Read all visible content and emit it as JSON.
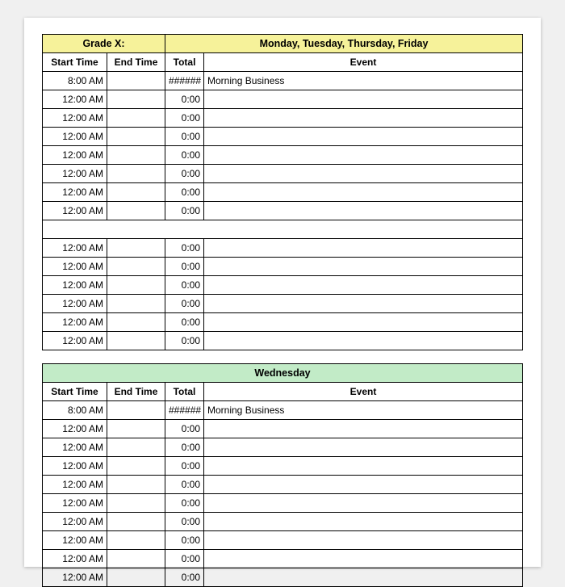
{
  "table1": {
    "title_left": "Grade X:",
    "title_right": "Monday, Tuesday, Thursday, Friday",
    "headers": {
      "start": "Start Time",
      "end": "End Time",
      "total": "Total",
      "event": "Event"
    },
    "rows": [
      {
        "start": "8:00 AM",
        "end": "",
        "total": "######",
        "event": "Morning Business"
      },
      {
        "start": "12:00 AM",
        "end": "",
        "total": "0:00",
        "event": ""
      },
      {
        "start": "12:00 AM",
        "end": "",
        "total": "0:00",
        "event": ""
      },
      {
        "start": "12:00 AM",
        "end": "",
        "total": "0:00",
        "event": ""
      },
      {
        "start": "12:00 AM",
        "end": "",
        "total": "0:00",
        "event": ""
      },
      {
        "start": "12:00 AM",
        "end": "",
        "total": "0:00",
        "event": ""
      },
      {
        "start": "12:00 AM",
        "end": "",
        "total": "0:00",
        "event": ""
      },
      {
        "start": "12:00 AM",
        "end": "",
        "total": "0:00",
        "event": ""
      },
      {
        "spacer": true
      },
      {
        "start": "12:00 AM",
        "end": "",
        "total": "0:00",
        "event": ""
      },
      {
        "start": "12:00 AM",
        "end": "",
        "total": "0:00",
        "event": ""
      },
      {
        "start": "12:00 AM",
        "end": "",
        "total": "0:00",
        "event": ""
      },
      {
        "start": "12:00 AM",
        "end": "",
        "total": "0:00",
        "event": ""
      },
      {
        "start": "12:00 AM",
        "end": "",
        "total": "0:00",
        "event": ""
      },
      {
        "start": "12:00 AM",
        "end": "",
        "total": "0:00",
        "event": ""
      }
    ]
  },
  "table2": {
    "title": "Wednesday",
    "headers": {
      "start": "Start Time",
      "end": "End Time",
      "total": "Total",
      "event": "Event"
    },
    "rows": [
      {
        "start": "8:00 AM",
        "end": "",
        "total": "######",
        "event": "Morning Business"
      },
      {
        "start": "12:00 AM",
        "end": "",
        "total": "0:00",
        "event": ""
      },
      {
        "start": "12:00 AM",
        "end": "",
        "total": "0:00",
        "event": ""
      },
      {
        "start": "12:00 AM",
        "end": "",
        "total": "0:00",
        "event": ""
      },
      {
        "start": "12:00 AM",
        "end": "",
        "total": "0:00",
        "event": ""
      },
      {
        "start": "12:00 AM",
        "end": "",
        "total": "0:00",
        "event": ""
      },
      {
        "start": "12:00 AM",
        "end": "",
        "total": "0:00",
        "event": ""
      },
      {
        "start": "12:00 AM",
        "end": "",
        "total": "0:00",
        "event": ""
      },
      {
        "start": "12:00 AM",
        "end": "",
        "total": "0:00",
        "event": ""
      },
      {
        "start": "12:00 AM",
        "end": "",
        "total": "0:00",
        "event": ""
      }
    ]
  }
}
